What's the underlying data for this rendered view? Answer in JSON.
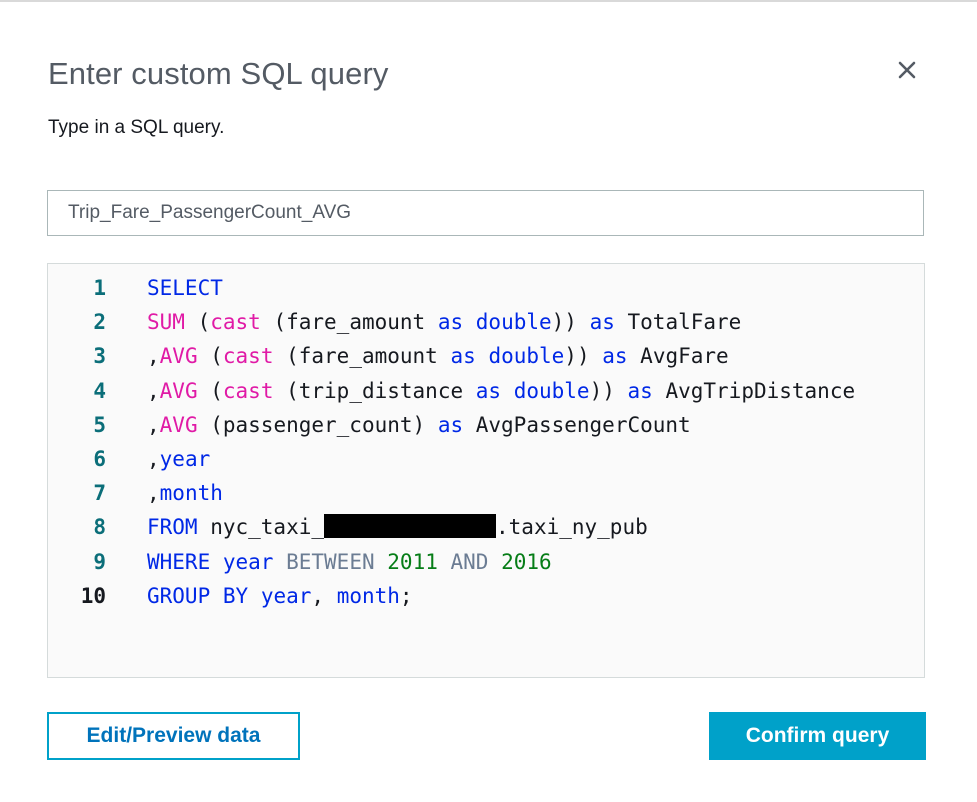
{
  "dialog": {
    "title": "Enter custom SQL query",
    "subtitle": "Type in a SQL query.",
    "close_icon": "close-icon"
  },
  "query_name": {
    "value": "Trip_Fare_PassengerCount_AVG"
  },
  "editor": {
    "line_numbers": [
      "1",
      "2",
      "3",
      "4",
      "5",
      "6",
      "7",
      "8",
      "9",
      "10"
    ],
    "lines": [
      [
        {
          "t": "SELECT",
          "c": "kw"
        }
      ],
      [
        {
          "t": "SUM",
          "c": "fn"
        },
        {
          "t": " ("
        },
        {
          "t": "cast",
          "c": "fn"
        },
        {
          "t": " (fare_amount "
        },
        {
          "t": "as",
          "c": "kw"
        },
        {
          "t": " "
        },
        {
          "t": "double",
          "c": "kw"
        },
        {
          "t": ")) "
        },
        {
          "t": "as",
          "c": "kw"
        },
        {
          "t": " TotalFare"
        }
      ],
      [
        {
          "t": ","
        },
        {
          "t": "AVG",
          "c": "fn"
        },
        {
          "t": " ("
        },
        {
          "t": "cast",
          "c": "fn"
        },
        {
          "t": " (fare_amount "
        },
        {
          "t": "as",
          "c": "kw"
        },
        {
          "t": " "
        },
        {
          "t": "double",
          "c": "kw"
        },
        {
          "t": ")) "
        },
        {
          "t": "as",
          "c": "kw"
        },
        {
          "t": " AvgFare"
        }
      ],
      [
        {
          "t": ","
        },
        {
          "t": "AVG",
          "c": "fn"
        },
        {
          "t": " ("
        },
        {
          "t": "cast",
          "c": "fn"
        },
        {
          "t": " (trip_distance "
        },
        {
          "t": "as",
          "c": "kw"
        },
        {
          "t": " "
        },
        {
          "t": "double",
          "c": "kw"
        },
        {
          "t": ")) "
        },
        {
          "t": "as",
          "c": "kw"
        },
        {
          "t": " AvgTripDistance"
        }
      ],
      [
        {
          "t": ","
        },
        {
          "t": "AVG",
          "c": "fn"
        },
        {
          "t": " (passenger_count) "
        },
        {
          "t": "as",
          "c": "kw"
        },
        {
          "t": " AvgPassengerCount"
        }
      ],
      [
        {
          "t": ","
        },
        {
          "t": "year",
          "c": "kw"
        }
      ],
      [
        {
          "t": ","
        },
        {
          "t": "month",
          "c": "kw"
        }
      ],
      [
        {
          "t": "FROM",
          "c": "kw"
        },
        {
          "t": " nyc_taxi_"
        },
        {
          "redacted": true
        },
        {
          "t": ".taxi_ny_pub"
        }
      ],
      [
        {
          "t": "WHERE",
          "c": "kw"
        },
        {
          "t": " "
        },
        {
          "t": "year",
          "c": "kw"
        },
        {
          "t": " "
        },
        {
          "t": "BETWEEN",
          "c": "op"
        },
        {
          "t": " "
        },
        {
          "t": "2011",
          "c": "num"
        },
        {
          "t": " "
        },
        {
          "t": "AND",
          "c": "op"
        },
        {
          "t": " "
        },
        {
          "t": "2016",
          "c": "num"
        }
      ],
      [
        {
          "t": "GROUP BY",
          "c": "kw"
        },
        {
          "t": " "
        },
        {
          "t": "year",
          "c": "kw"
        },
        {
          "t": ", "
        },
        {
          "t": "month",
          "c": "kw"
        },
        {
          "t": ";"
        }
      ]
    ]
  },
  "buttons": {
    "edit_preview_label": "Edit/Preview data",
    "confirm_label": "Confirm query"
  },
  "colors": {
    "accent": "#00a1c9",
    "keyword": "#0028e6",
    "function": "#e01aa6",
    "number": "#067d17",
    "operator": "#6b7c93",
    "line_number": "#0b6e79"
  }
}
